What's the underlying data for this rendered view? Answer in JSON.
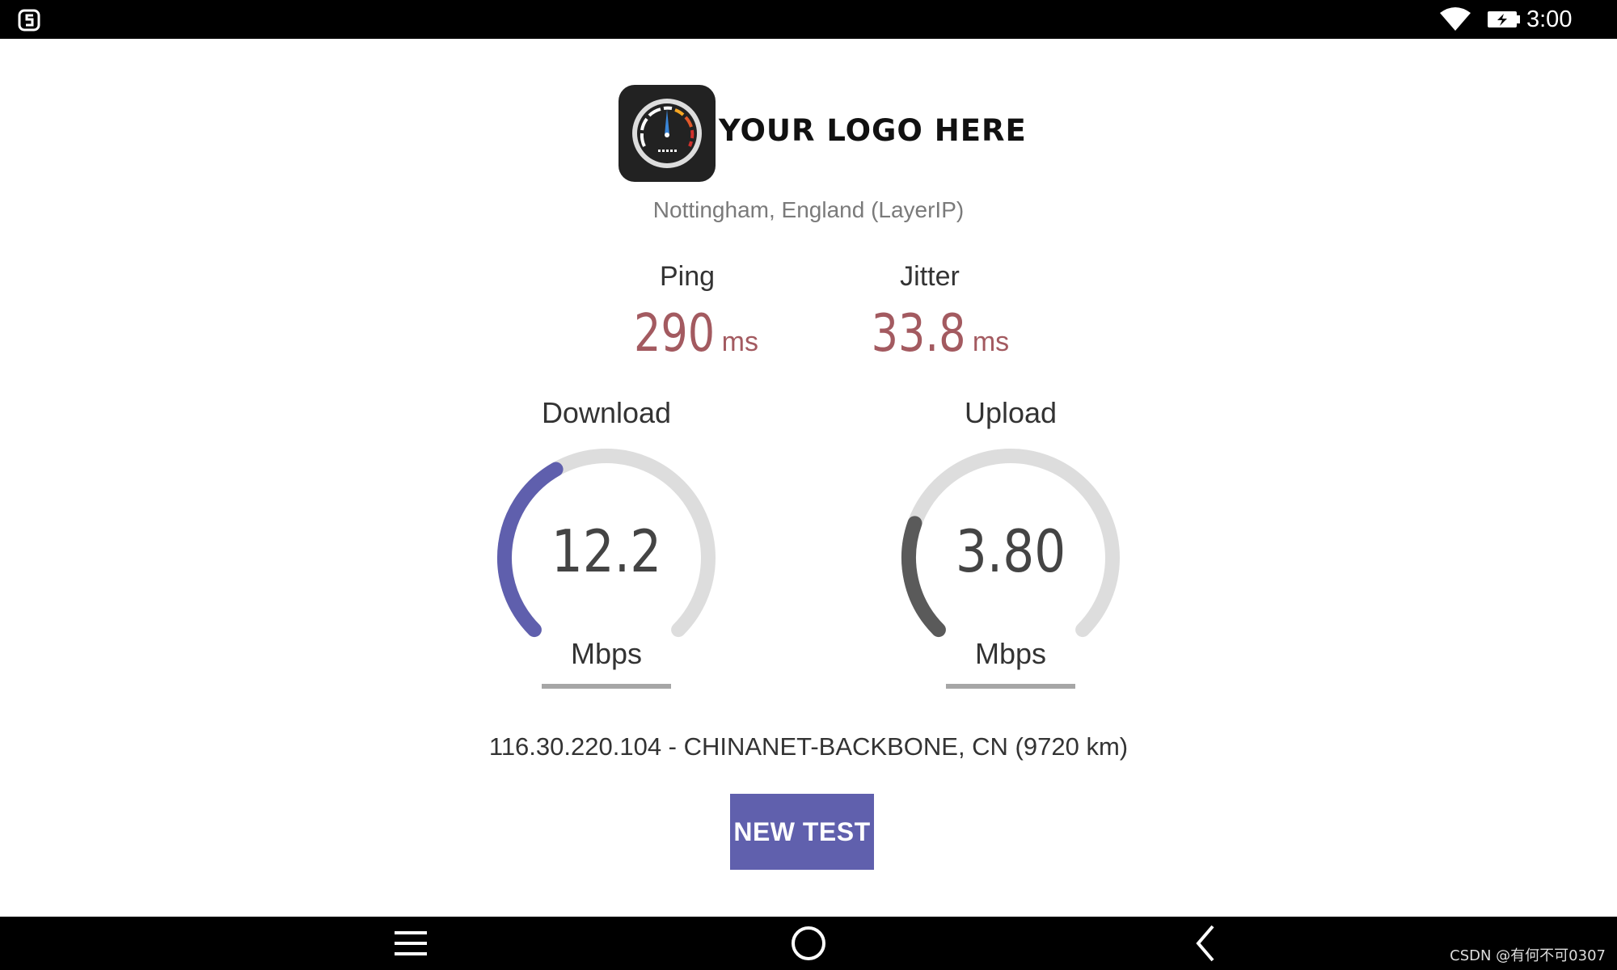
{
  "status_bar": {
    "time": "3:00",
    "icons": [
      "app-s-icon",
      "wifi-icon",
      "battery-charging-icon"
    ]
  },
  "logo": {
    "text": "YOUR LOGO HERE",
    "icon": "speedometer-icon"
  },
  "server_location": "Nottingham, England (LayerIP)",
  "ping": {
    "label": "Ping",
    "value": "290",
    "unit": "ms"
  },
  "jitter": {
    "label": "Jitter",
    "value": "33.8",
    "unit": "ms"
  },
  "download": {
    "label": "Download",
    "value": "12.2",
    "unit": "Mbps",
    "gauge_fill_fraction": 0.39,
    "color": "#5f5fad"
  },
  "upload": {
    "label": "Upload",
    "value": "3.80",
    "unit": "Mbps",
    "gauge_fill_fraction": 0.24,
    "color": "#5a5a5a"
  },
  "gauge_track_color": "#dddddd",
  "accent_color": "#6060ad",
  "value_color": "#a35a60",
  "server_info": "116.30.220.104 - CHINANET-BACKBONE, CN (9720 km)",
  "new_test_label": "NEW TEST",
  "nav_bar": {
    "icons": [
      "menu-icon",
      "home-icon",
      "back-icon"
    ]
  },
  "watermark": "CSDN @有何不可0307"
}
